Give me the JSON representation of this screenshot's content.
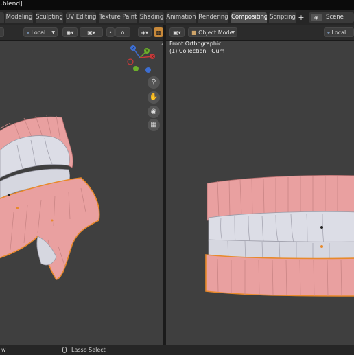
{
  "window": {
    "title": ".blend]"
  },
  "workspace_tabs": [
    {
      "label": "Modeling"
    },
    {
      "label": "Sculpting"
    },
    {
      "label": "UV Editing"
    },
    {
      "label": "Texture Paint"
    },
    {
      "label": "Shading"
    },
    {
      "label": "Animation"
    },
    {
      "label": "Rendering"
    },
    {
      "label": "Compositing"
    },
    {
      "label": "Scripting"
    }
  ],
  "add_workspace": "+",
  "scene": {
    "label": "Scene",
    "icon": "scene-icon"
  },
  "left_viewport": {
    "header": {
      "transform_orientation": "Local",
      "pivot_icon": "pivot-icon",
      "snap_icon": "snap-icon",
      "proportional_icon": "proportional-edit-icon",
      "overlay_icon": "overlay-icon"
    },
    "nav_icons": [
      "zoom-icon",
      "hand-pan-icon",
      "camera-icon",
      "grid-icon"
    ],
    "gizmo_axes": [
      "X",
      "Y",
      "Z"
    ]
  },
  "right_viewport": {
    "header": {
      "editor_icon": "3d-viewport-icon",
      "mode": "Object Mode",
      "transform_orientation": "Local"
    },
    "view_name": "Front Orthographic",
    "collection_info": "(1) Collection | Gum"
  },
  "status_bar": {
    "left_text": "w",
    "select_tool": "Lasso Select"
  },
  "colors": {
    "viewport_bg": "#3f3f3f",
    "gum": "#e9a0a0",
    "teeth": "#dcdde6",
    "selection_outline": "#e8892a",
    "accent_active": "#c8893a"
  }
}
